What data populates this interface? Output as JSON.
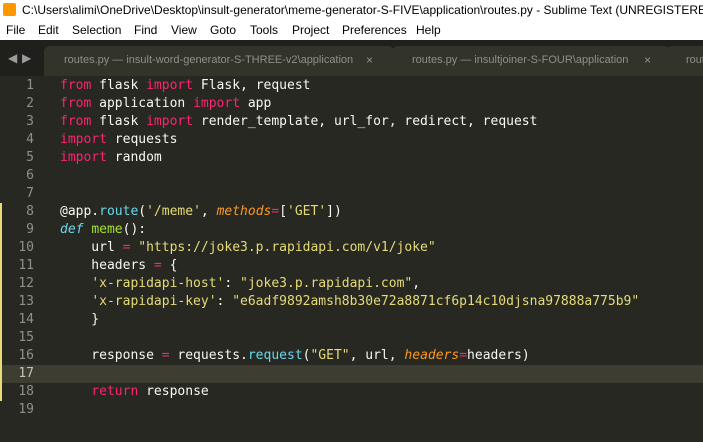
{
  "window": {
    "title": "C:\\Users\\alimi\\OneDrive\\Desktop\\insult-generator\\meme-generator-S-FIVE\\application\\routes.py - Sublime Text (UNREGISTERED)"
  },
  "menu": [
    "File",
    "Edit",
    "Selection",
    "Find",
    "View",
    "Goto",
    "Tools",
    "Project",
    "Preferences",
    "Help"
  ],
  "tabs": [
    {
      "label": "routes.py — insult-word-generator-S-THREE-v2\\application",
      "close": "×"
    },
    {
      "label": "routes.py — insultjoiner-S-FOUR\\application",
      "close": "×"
    },
    {
      "label": "routes.py",
      "close": ""
    }
  ],
  "tab_nav": {
    "prev": "◀",
    "next": "▶"
  },
  "colors": {
    "background": "#272822",
    "keyword": "#f92672",
    "string": "#e6db74",
    "function": "#a6e22e",
    "storage": "#66d9ef",
    "argument": "#fd971f"
  },
  "editor": {
    "current_line": 17,
    "modified_lines": [
      8,
      9,
      10,
      11,
      12,
      13,
      14,
      15,
      16,
      17,
      18
    ],
    "lines": [
      {
        "n": "1",
        "tokens": [
          [
            "kw",
            "from"
          ],
          [
            "plain",
            " flask "
          ],
          [
            "kw",
            "import"
          ],
          [
            "plain",
            " Flask, request"
          ]
        ]
      },
      {
        "n": "2",
        "tokens": [
          [
            "kw",
            "from"
          ],
          [
            "plain",
            " application "
          ],
          [
            "kw",
            "import"
          ],
          [
            "plain",
            " app"
          ]
        ]
      },
      {
        "n": "3",
        "tokens": [
          [
            "kw",
            "from"
          ],
          [
            "plain",
            " flask "
          ],
          [
            "kw",
            "import"
          ],
          [
            "plain",
            " render_template, url_for, redirect, request"
          ]
        ]
      },
      {
        "n": "4",
        "tokens": [
          [
            "kw",
            "import"
          ],
          [
            "plain",
            " requests"
          ]
        ]
      },
      {
        "n": "5",
        "tokens": [
          [
            "kw",
            "import"
          ],
          [
            "plain",
            " random"
          ]
        ]
      },
      {
        "n": "6",
        "tokens": []
      },
      {
        "n": "7",
        "tokens": []
      },
      {
        "n": "8",
        "tokens": [
          [
            "plain",
            "@app."
          ],
          [
            "bi",
            "route"
          ],
          [
            "plain",
            "("
          ],
          [
            "str",
            "'/meme'"
          ],
          [
            "plain",
            ", "
          ],
          [
            "arg",
            "methods"
          ],
          [
            "kw",
            "="
          ],
          [
            "plain",
            "["
          ],
          [
            "str",
            "'GET'"
          ],
          [
            "plain",
            "])"
          ]
        ]
      },
      {
        "n": "9",
        "tokens": [
          [
            "st",
            "def"
          ],
          [
            "plain",
            " "
          ],
          [
            "fn",
            "meme"
          ],
          [
            "plain",
            "():"
          ]
        ]
      },
      {
        "n": "10",
        "tokens": [
          [
            "plain",
            "    url "
          ],
          [
            "kw",
            "="
          ],
          [
            "plain",
            " "
          ],
          [
            "str",
            "\"https://joke3.p.rapidapi.com/v1/joke\""
          ]
        ]
      },
      {
        "n": "11",
        "tokens": [
          [
            "plain",
            "    headers "
          ],
          [
            "kw",
            "="
          ],
          [
            "plain",
            " {"
          ]
        ]
      },
      {
        "n": "12",
        "tokens": [
          [
            "plain",
            "    "
          ],
          [
            "str",
            "'x-rapidapi-host'"
          ],
          [
            "plain",
            ": "
          ],
          [
            "str",
            "\"joke3.p.rapidapi.com\""
          ],
          [
            "plain",
            ","
          ]
        ]
      },
      {
        "n": "13",
        "tokens": [
          [
            "plain",
            "    "
          ],
          [
            "str",
            "'x-rapidapi-key'"
          ],
          [
            "plain",
            ": "
          ],
          [
            "str",
            "\"e6adf9892amsh8b30e72a8871cf6p14c10djsna97888a775b9\""
          ]
        ]
      },
      {
        "n": "14",
        "tokens": [
          [
            "plain",
            "    }"
          ]
        ]
      },
      {
        "n": "15",
        "tokens": []
      },
      {
        "n": "16",
        "tokens": [
          [
            "plain",
            "    response "
          ],
          [
            "kw",
            "="
          ],
          [
            "plain",
            " requests."
          ],
          [
            "bi",
            "request"
          ],
          [
            "plain",
            "("
          ],
          [
            "str",
            "\"GET\""
          ],
          [
            "plain",
            ", url, "
          ],
          [
            "arg",
            "headers"
          ],
          [
            "kw",
            "="
          ],
          [
            "plain",
            "headers)"
          ]
        ]
      },
      {
        "n": "17",
        "tokens": []
      },
      {
        "n": "18",
        "tokens": [
          [
            "plain",
            "    "
          ],
          [
            "kw",
            "return"
          ],
          [
            "plain",
            " response"
          ]
        ]
      },
      {
        "n": "19",
        "tokens": []
      }
    ]
  }
}
